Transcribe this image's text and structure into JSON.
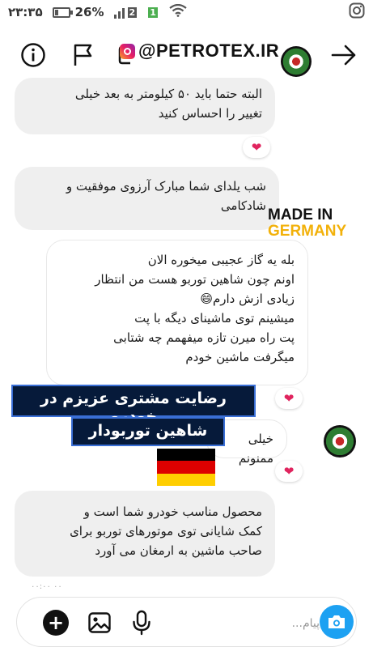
{
  "status_bar": {
    "time": "۲۳:۳۵",
    "battery": "26%",
    "battery_level": 0.26,
    "sim1": "2",
    "sim2": "1",
    "icons": [
      "battery-icon",
      "signal-icon",
      "wifi-icon",
      "instagram-icon"
    ]
  },
  "header": {
    "watermark": "@PETROTEX.IR",
    "icons": [
      "info-icon",
      "flag-icon",
      "video-call-icon",
      "profile-avatar",
      "arrow-forward-icon"
    ]
  },
  "messages": [
    {
      "text": "البته حتما باید ۵۰ کیلومتر به بعد خیلی\nتغییر را احساس کنید",
      "reaction": "❤"
    },
    {
      "text": "شب یلدای شما مبارک آرزوی موفقیت و\nشادکامی",
      "reaction": ""
    },
    {
      "text": "بله یه گاز عجیبی میخوره الان\nاونم چون شاهین توربو هست من انتظار\nزیادی ازش دارم😄\nمیشینم توی ماشینای دیگه با پت\nپت راه میرن تازه میفهمم چه شتابی\nمیگرفت ماشین خودم",
      "reaction": "❤"
    },
    {
      "text": "خیلی ممنونم",
      "reaction": "❤"
    },
    {
      "text": "محصول مناسب خودرو شما است و\nکمک شایانی توی موتورهای توربو برای\nصاحب ماشین به ارمغان می آورد",
      "reaction": ""
    }
  ],
  "overlays": {
    "made_in": "MADE IN",
    "germany": "GERMANY",
    "caption_line1": "رضایت مشتری عزیزم در خودرو",
    "caption_line2": "شاهین توربودار"
  },
  "flag_colors": [
    "#000000",
    "#dd0000",
    "#ffce00"
  ],
  "timestamp": "۰۰:۰۰ ۰۰",
  "composer": {
    "placeholder": "پیام...",
    "value": ""
  },
  "colors": {
    "bubble": "#efefef",
    "heart": "#e0245e",
    "camera": "#1da1f2",
    "overlay_bg": "#061a3a"
  }
}
